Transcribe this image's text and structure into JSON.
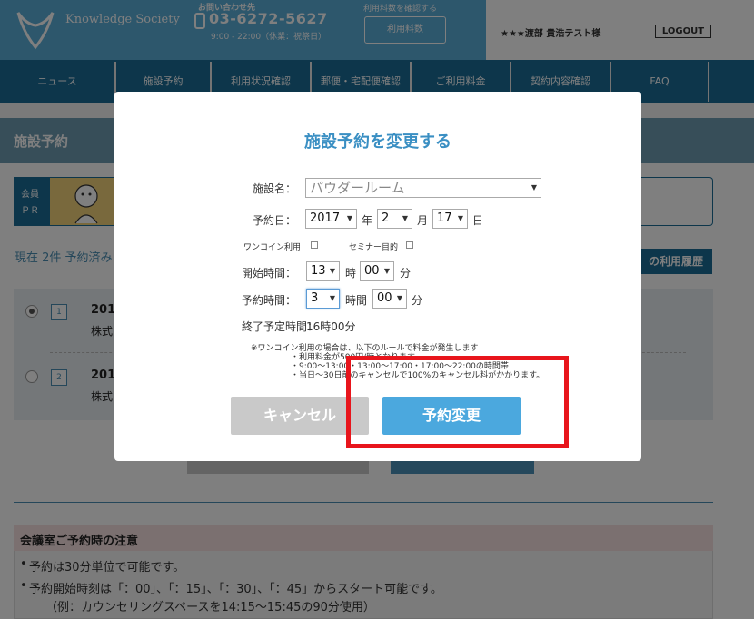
{
  "header": {
    "logo_text": "Knowledge Society",
    "contact_title": "お問い合わせ先",
    "phone": "03-6272-5627",
    "hours": "9:00 - 22:00（休業：祝祭日）",
    "usage_note": "利用料数を確認する",
    "usage_button": "利用料数",
    "user_name": "★★★渡部 貴浩テスト様",
    "logout": "LOGOUT"
  },
  "nav": {
    "items": [
      {
        "label": "ニュース"
      },
      {
        "label": "施設予約"
      },
      {
        "label": "利用状況確認"
      },
      {
        "label": "郵便・宅配便確認"
      },
      {
        "label": "ご利用料金"
      },
      {
        "label": "契約内容確認"
      },
      {
        "label": "FAQ"
      }
    ]
  },
  "page": {
    "title": "施設予約",
    "member_pr_label": "会員\nPR",
    "booking_count": "現在 2件 予約済み",
    "history_button": "の利用履歴",
    "reservations": [
      {
        "number": "1",
        "date": "201",
        "company": "株式",
        "selected": true
      },
      {
        "number": "2",
        "date": "201",
        "company": "株式",
        "selected": false
      }
    ],
    "notice": {
      "title": "会議室ご予約時の注意",
      "items": [
        "予約は30分単位で可能です。",
        "予約開始時刻は「：00」、「：15」、「：30」、「：45」からスタート可能です。",
        "（例：カウンセリングスペースを14:15～15:45の90分使用）"
      ]
    }
  },
  "modal": {
    "title": "施設予約を変更する",
    "facility_label": "施設名：",
    "facility_value": "パウダールーム",
    "date_label": "予約日：",
    "year": "2017",
    "year_unit": "年",
    "month": "2",
    "month_unit": "月",
    "day": "17",
    "day_unit": "日",
    "one_coin_label": "ワンコイン利用",
    "seminar_label": "セミナー目的",
    "start_label": "開始時間：",
    "start_hour": "13",
    "hour_unit": "時",
    "start_min": "00",
    "min_unit": "分",
    "duration_label": "予約時間：",
    "duration_hours": "3",
    "duration_hour_unit": "時間",
    "duration_min": "00",
    "duration_min_unit": "分",
    "end_label": "終了予定時間：",
    "end_value": "16時00分",
    "notes": [
      "※ワンコイン利用の場合は、以下のルールで料金が発生します",
      "・利用料金が500円/時となります",
      "・9:00～13:00・13:00～17:00・17:00～22:00の時間帯",
      "・当日～30日前のキャンセルで100%のキャンセル料がかかります。"
    ],
    "cancel_button": "キャンセル",
    "change_button": "予約変更"
  }
}
